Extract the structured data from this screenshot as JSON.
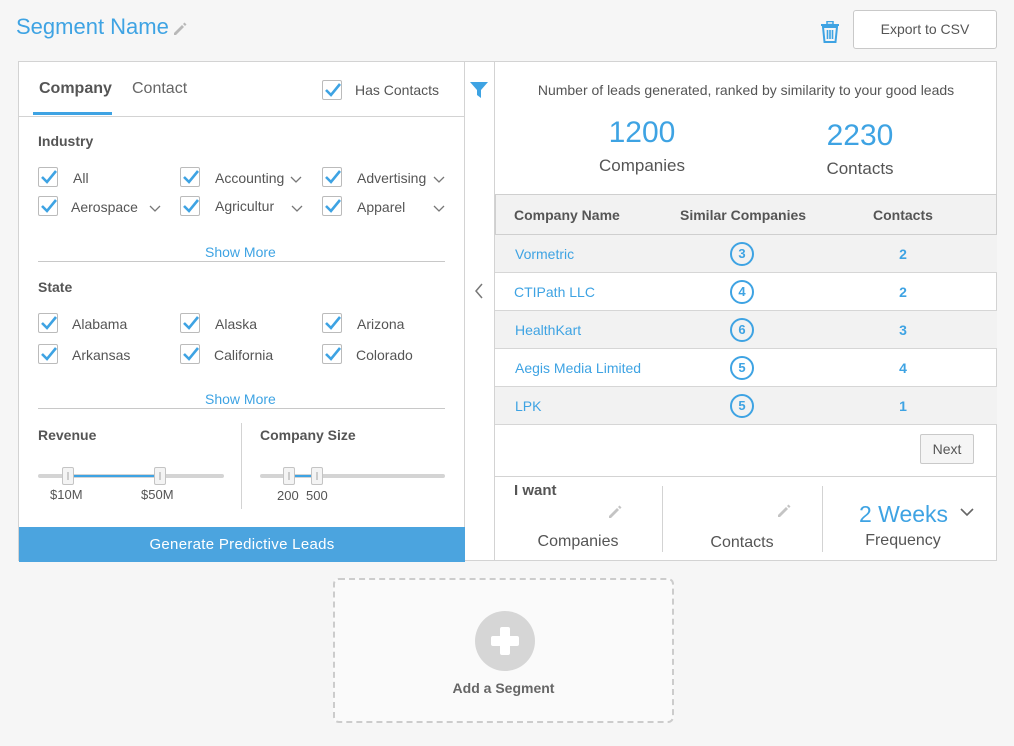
{
  "header": {
    "title": "Segment Name",
    "export_label": "Export to CSV"
  },
  "filters": {
    "tabs": [
      "Company",
      "Contact"
    ],
    "has_contacts_label": "Has Contacts",
    "industry": {
      "title": "Industry",
      "items": [
        "All",
        "Accounting",
        "Advertising",
        "Aerospace",
        "Agricultur",
        "Apparel"
      ],
      "show_more": "Show More"
    },
    "state": {
      "title": "State",
      "items": [
        "Alabama",
        "Alaska",
        "Arizona",
        "Arkansas",
        "California",
        "Colorado"
      ],
      "show_more": "Show More"
    },
    "revenue": {
      "title": "Revenue",
      "min_label": "$10M",
      "max_label": "$50M"
    },
    "company_size": {
      "title": "Company Size",
      "min_label": "200",
      "max_label": "500"
    },
    "generate_label": "Generate Predictive Leads"
  },
  "results": {
    "caption": "Number of leads generated, ranked by similarity to your good leads",
    "companies_count": "1200",
    "companies_label": "Companies",
    "contacts_count": "2230",
    "contacts_label": "Contacts",
    "columns": [
      "Company Name",
      "Similar Companies",
      "Contacts"
    ],
    "rows": [
      {
        "name": "Vormetric",
        "similar": "3",
        "contacts": "2"
      },
      {
        "name": "CTIPath LLC",
        "similar": "4",
        "contacts": "2"
      },
      {
        "name": "HealthKart",
        "similar": "6",
        "contacts": "3"
      },
      {
        "name": "Aegis Media Limited",
        "similar": "5",
        "contacts": "4"
      },
      {
        "name": "LPK",
        "similar": "5",
        "contacts": "1"
      }
    ],
    "next_label": "Next"
  },
  "i_want": {
    "title": "I want",
    "companies_label": "Companies",
    "contacts_label": "Contacts",
    "frequency_value": "2 Weeks",
    "frequency_label": "Frequency"
  },
  "add_segment_label": "Add a Segment",
  "colors": {
    "accent": "#3ea3e3",
    "button": "#4ba4df"
  }
}
